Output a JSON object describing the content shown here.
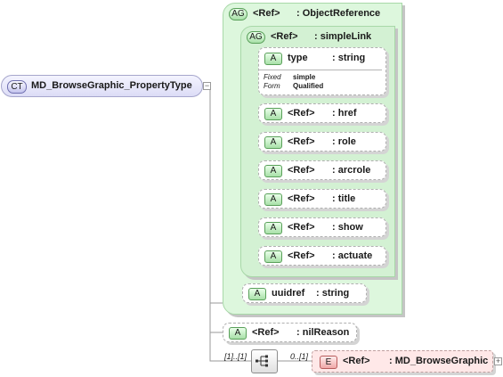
{
  "complex_type": {
    "badge": "CT",
    "name": "MD_BrowseGraphic_PropertyType"
  },
  "object_reference": {
    "badge": "AG",
    "ref": "<Ref>",
    "type": ": ObjectReference"
  },
  "simple_link": {
    "badge": "AG",
    "ref": "<Ref>",
    "type": ": simpleLink"
  },
  "type_attribute": {
    "badge": "A",
    "name": "type",
    "type": ": string",
    "fixed_label": "Fixed",
    "form_label": "Form",
    "fixed_value": "simple",
    "form_value": "Qualified"
  },
  "link_attributes": [
    {
      "badge": "A",
      "ref": "<Ref>",
      "type": ": href"
    },
    {
      "badge": "A",
      "ref": "<Ref>",
      "type": ": role"
    },
    {
      "badge": "A",
      "ref": "<Ref>",
      "type": ": arcrole"
    },
    {
      "badge": "A",
      "ref": "<Ref>",
      "type": ": title"
    },
    {
      "badge": "A",
      "ref": "<Ref>",
      "type": ": show"
    },
    {
      "badge": "A",
      "ref": "<Ref>",
      "type": ": actuate"
    }
  ],
  "uuidref": {
    "badge": "A",
    "name": "uuidref",
    "type": ": string"
  },
  "nil_reason": {
    "badge": "A",
    "ref": "<Ref>",
    "type": ": nilReason"
  },
  "sequence": {
    "cardinality": "[1]..[1]"
  },
  "browse_graphic": {
    "badge": "E",
    "ref": "<Ref>",
    "type": ": MD_BrowseGraphic",
    "cardinality": "0..[1]"
  },
  "colors": {
    "attribute_group": "#ddf7dd",
    "complex_type": "#dcdcf6",
    "element": "#ffe8e8"
  }
}
